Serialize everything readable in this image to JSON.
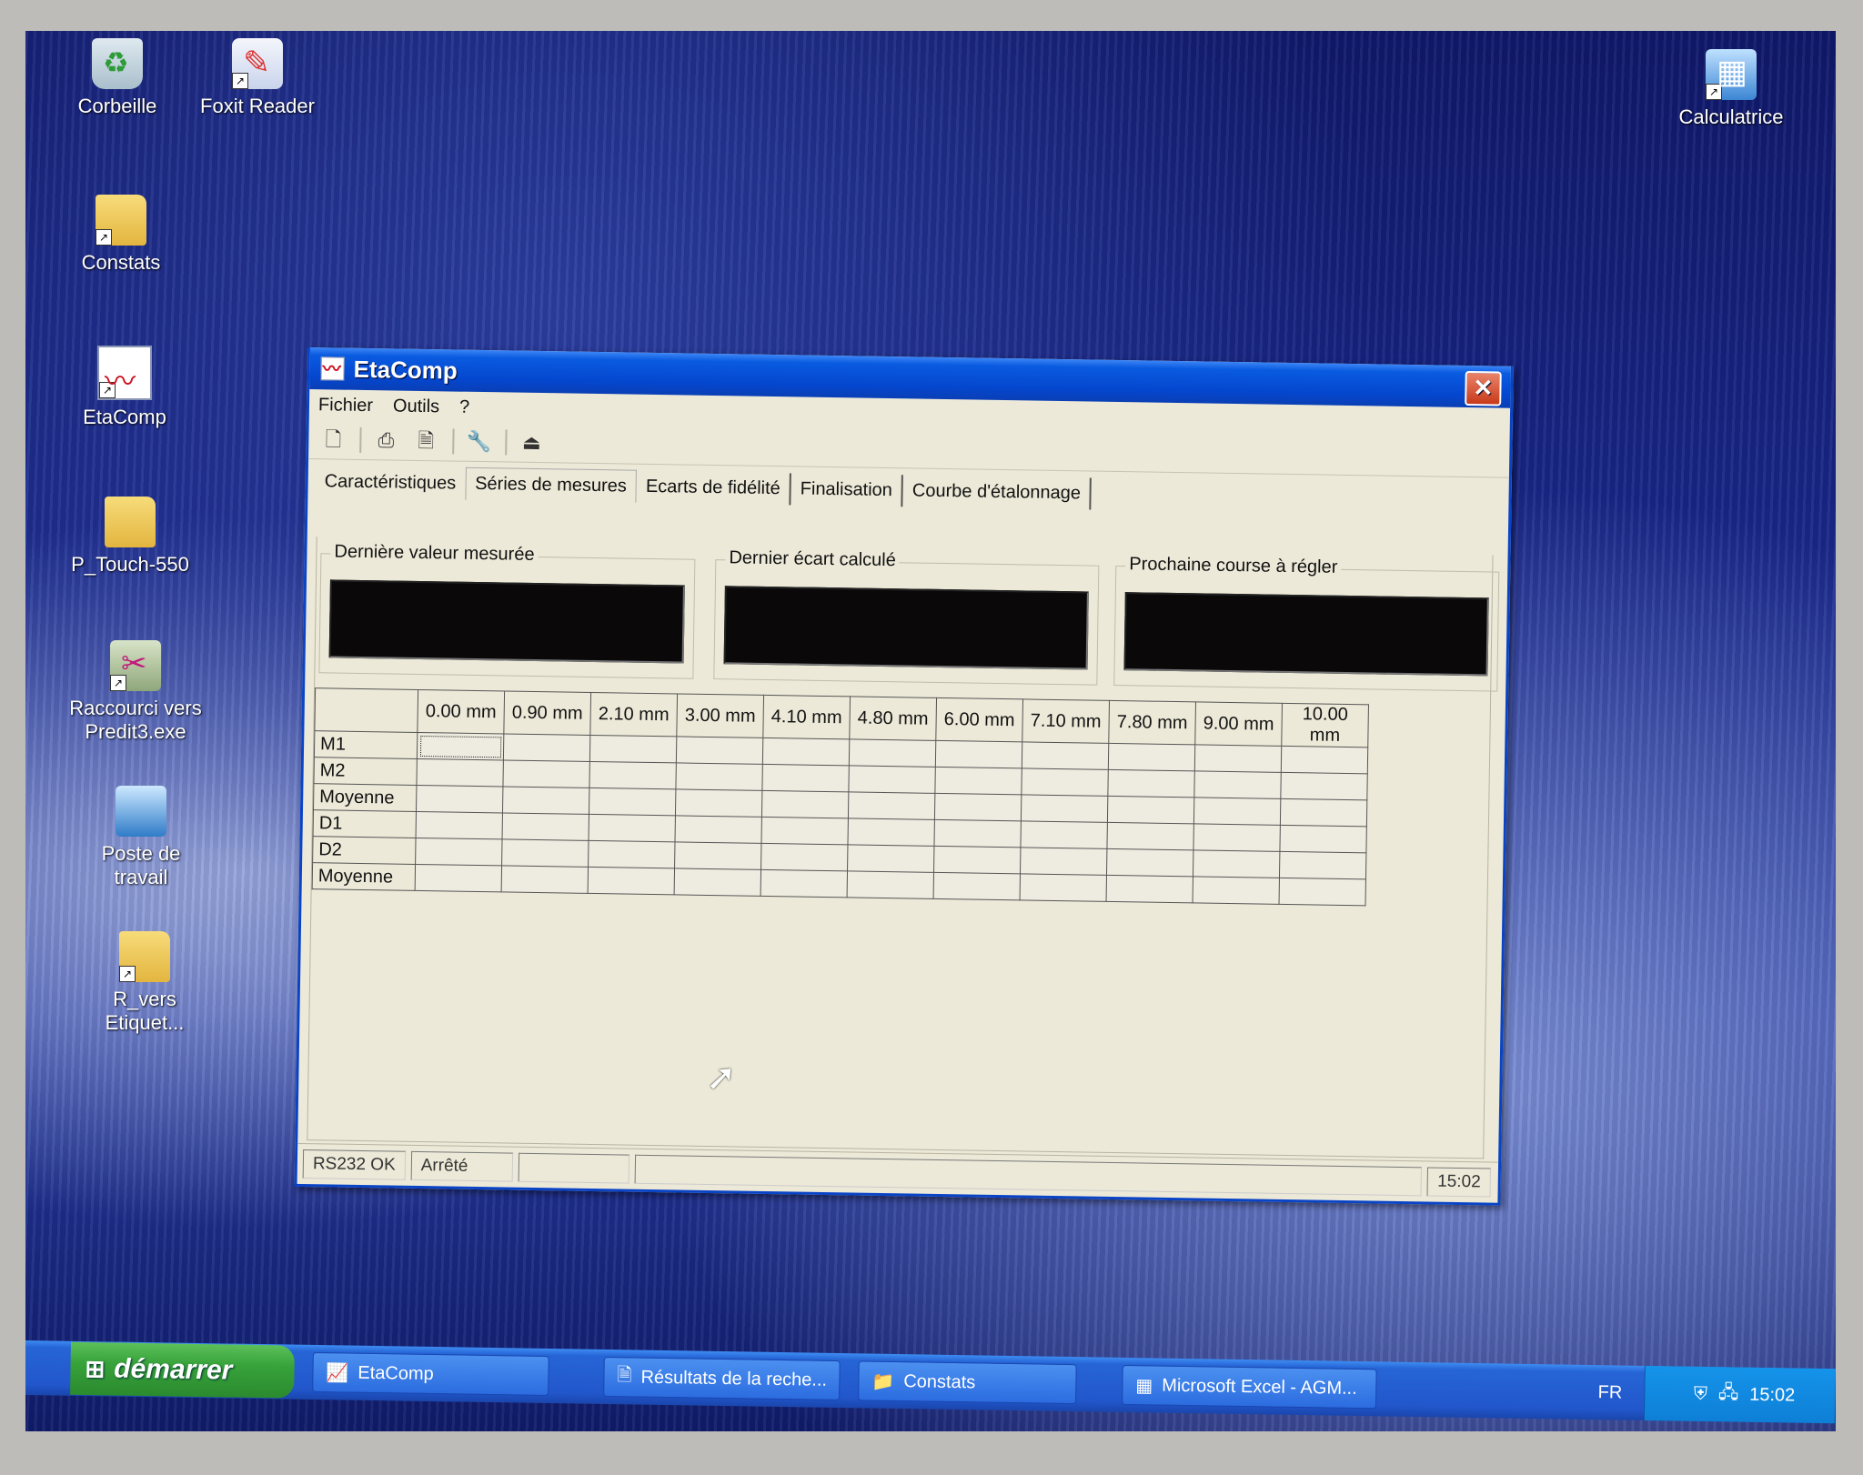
{
  "desktop": {
    "icons": [
      {
        "label": "Corbeille"
      },
      {
        "label": "Foxit Reader"
      },
      {
        "label": "Constats"
      },
      {
        "label": "EtaComp"
      },
      {
        "label": "P_Touch-550"
      },
      {
        "label": "Raccourci vers Predit3.exe"
      },
      {
        "label": "Poste de travail"
      },
      {
        "label": "R_vers Etiquet..."
      },
      {
        "label": "Calculatrice"
      }
    ]
  },
  "window": {
    "title": "EtaComp",
    "close_glyph": "✕",
    "menu": [
      "Fichier",
      "Outils",
      "?"
    ],
    "toolbar_icons": [
      "new-document-icon",
      "print-icon",
      "print-preview-icon",
      "settings-wrench-icon",
      "exit-door-icon"
    ],
    "tabs": [
      {
        "label": "Caractéristiques"
      },
      {
        "label": "Séries de mesures",
        "active": true
      },
      {
        "label": "Ecarts de fidélité"
      },
      {
        "label": "Finalisation"
      },
      {
        "label": "Courbe d'étalonnage"
      }
    ],
    "groups": {
      "last_value": {
        "label": "Dernière valeur mesurée",
        "value": ""
      },
      "last_deviation": {
        "label": "Dernier écart calculé",
        "value": ""
      },
      "next_travel": {
        "label": "Prochaine course à régler",
        "value": ""
      }
    },
    "grid": {
      "columns": [
        "0.00 mm",
        "0.90 mm",
        "2.10 mm",
        "3.00 mm",
        "4.10 mm",
        "4.80 mm",
        "6.00 mm",
        "7.10 mm",
        "7.80 mm",
        "9.00 mm",
        "10.00 mm"
      ],
      "rows": [
        "M1",
        "M2",
        "Moyenne",
        "D1",
        "D2",
        "Moyenne"
      ]
    },
    "status": {
      "port": "RS232 OK",
      "state": "Arrêté",
      "time": "15:02"
    }
  },
  "taskbar": {
    "start_label": "démarrer",
    "buttons": [
      {
        "label": "EtaComp"
      },
      {
        "label": "Résultats de la reche..."
      },
      {
        "label": "Constats"
      },
      {
        "label": "Microsoft Excel - AGM..."
      }
    ],
    "language": "FR",
    "clock": "15:02"
  }
}
